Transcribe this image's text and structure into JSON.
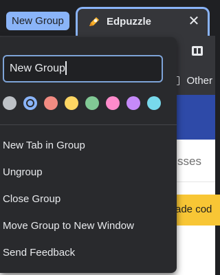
{
  "tab_strip": {
    "group_chip_label": "New Group",
    "group_color": "#8ab4f8",
    "active_tab": {
      "title": "Edpuzzle",
      "favicon": "edpuzzle-pencil-icon",
      "close_glyph": "✕"
    }
  },
  "toolbar": {
    "extension_icon": "puzzle-extension-icon"
  },
  "bookmarks_bar": {
    "other_label": "Other"
  },
  "page": {
    "nav_text_partial": "sses",
    "banner_text_partial": "ade cod"
  },
  "group_editor": {
    "name_value": "New Group",
    "colors": [
      {
        "name": "grey",
        "hex": "#bdc1c6",
        "selected": false
      },
      {
        "name": "blue",
        "hex": "#8ab4f8",
        "selected": true
      },
      {
        "name": "red",
        "hex": "#f28b82",
        "selected": false
      },
      {
        "name": "yellow",
        "hex": "#fdd663",
        "selected": false
      },
      {
        "name": "green",
        "hex": "#81c995",
        "selected": false
      },
      {
        "name": "pink",
        "hex": "#ff8bcb",
        "selected": false
      },
      {
        "name": "purple",
        "hex": "#c58af9",
        "selected": false
      },
      {
        "name": "cyan",
        "hex": "#78d9ec",
        "selected": false
      }
    ],
    "menu_items": [
      {
        "label": "New Tab in Group"
      },
      {
        "label": "Ungroup"
      },
      {
        "label": "Close Group"
      },
      {
        "label": "Move Group to New Window"
      },
      {
        "label": "Send Feedback"
      }
    ]
  }
}
